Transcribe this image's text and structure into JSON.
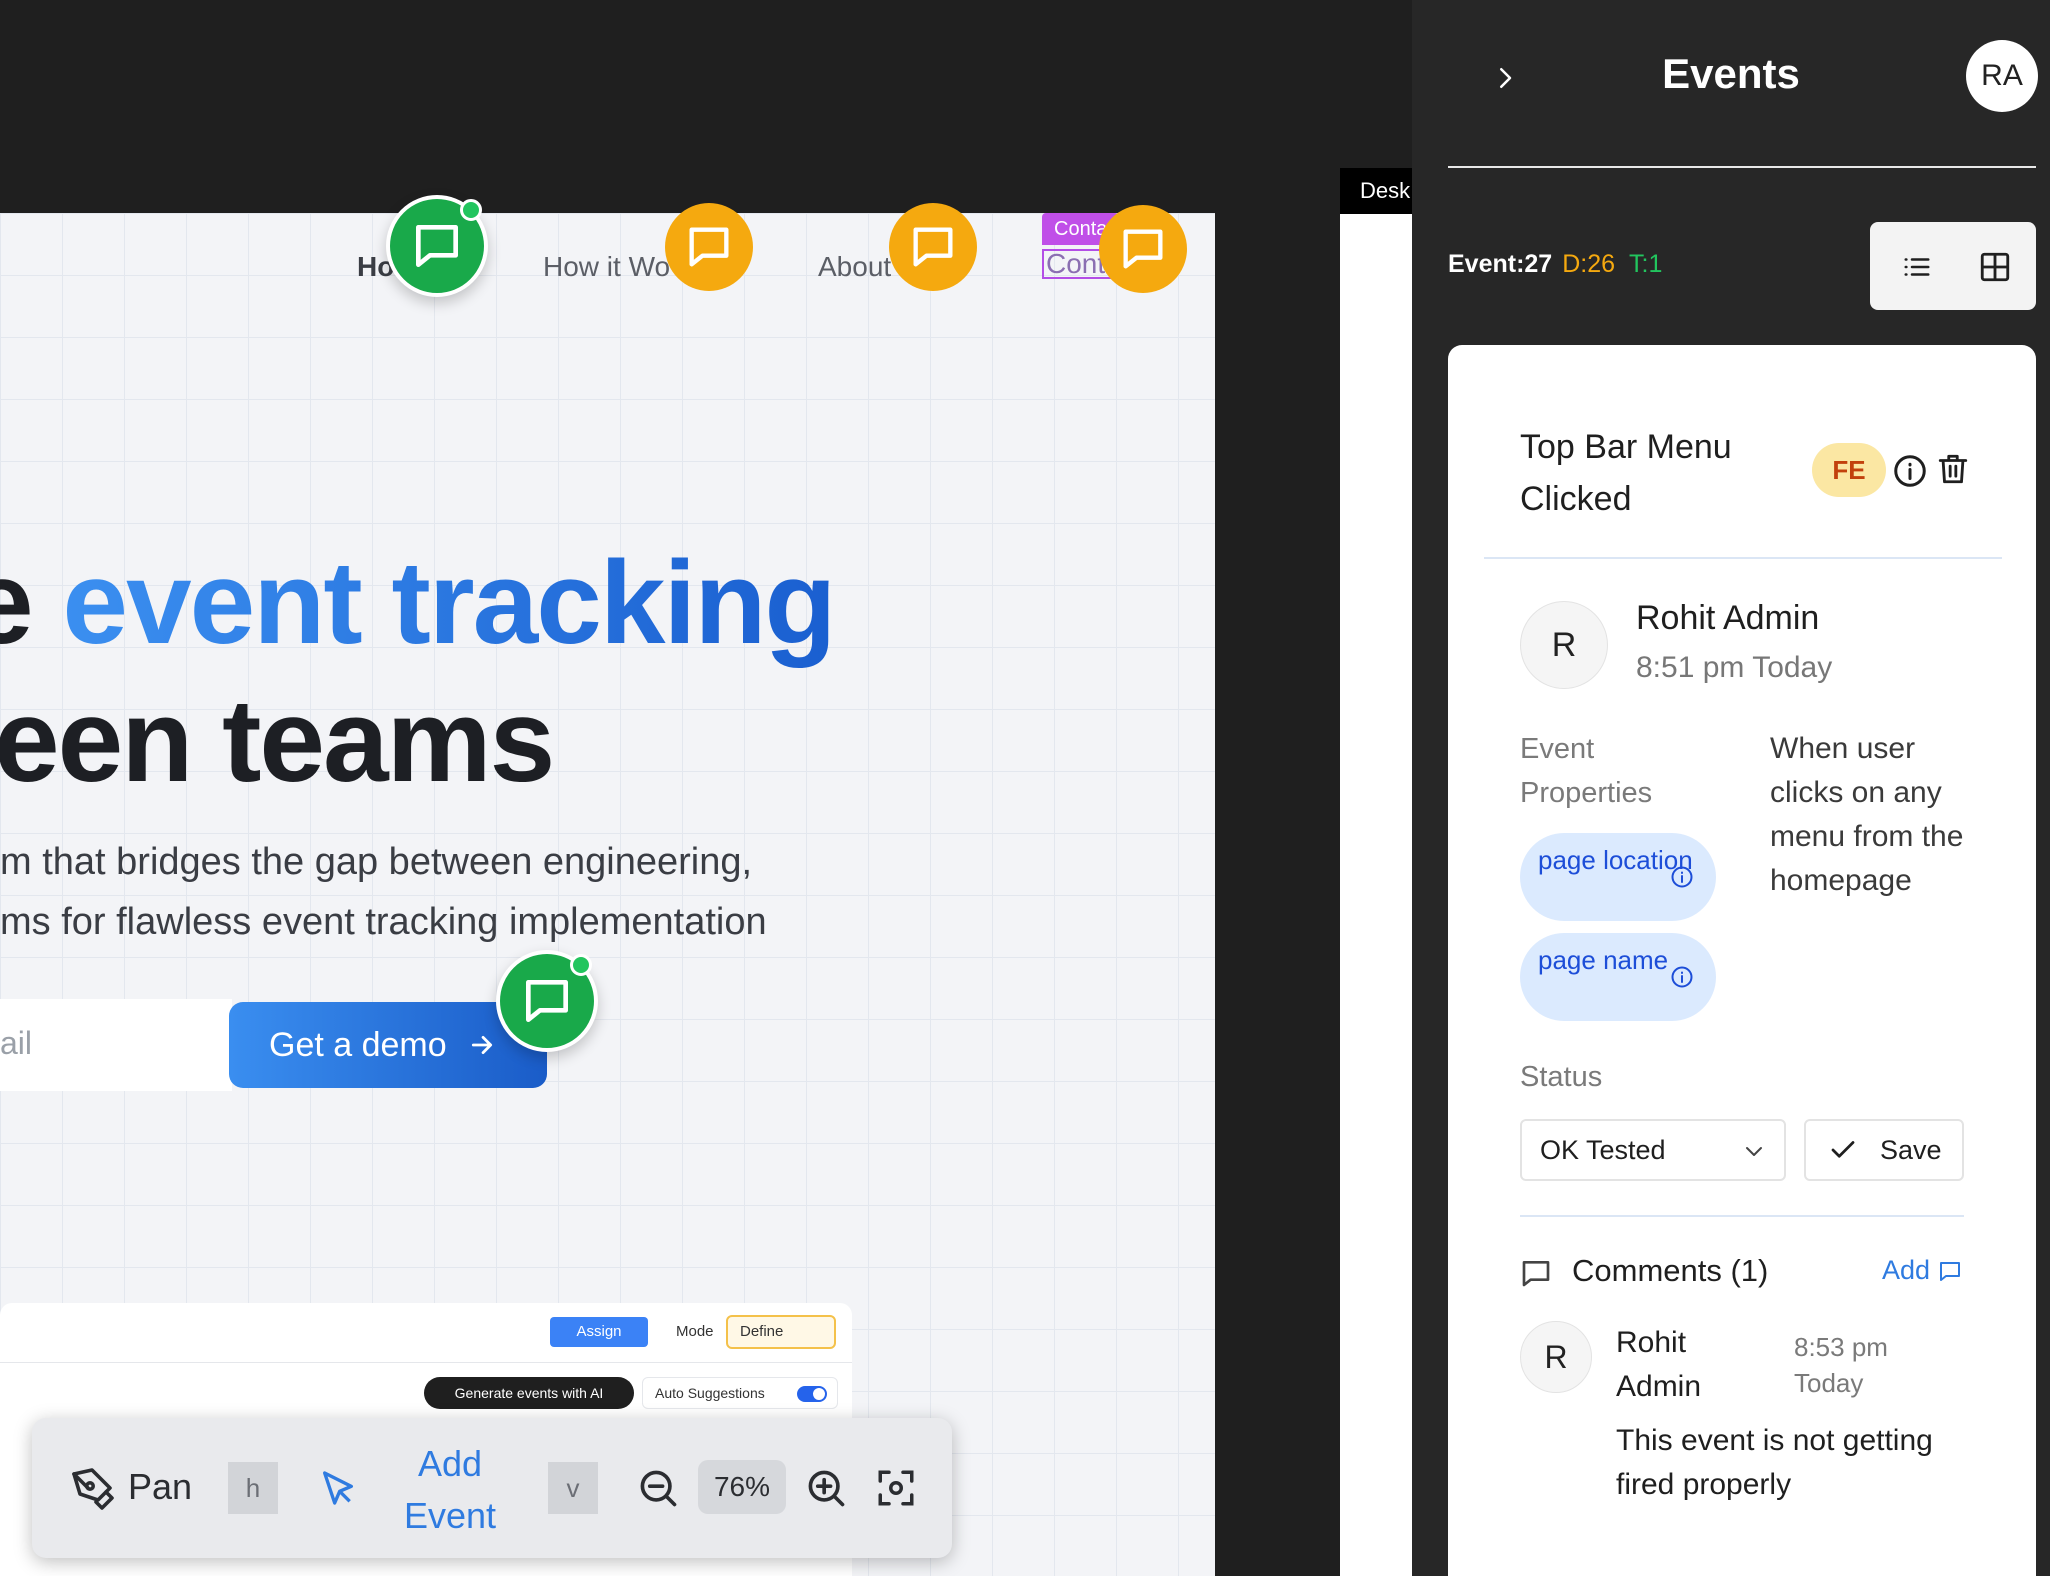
{
  "canvas": {
    "nav": {
      "home": "Ho",
      "how": "How it Wo",
      "about": "About",
      "contact": "Cont",
      "contact_tag": "Conta"
    },
    "hero": {
      "line1_prefix": "e ",
      "line1_accent": "event tracking",
      "line2": "een teams"
    },
    "subtitle": {
      "line1": "m that bridges the gap between engineering,",
      "line2": "ms for flawless event tracking implementation"
    },
    "email_placeholder": "ail",
    "demo_button": "Get a demo",
    "mock_app": {
      "assign": "Assign",
      "mode_label": "Mode",
      "mode_value": "Define",
      "generate": "Generate events with AI",
      "auto_suggestions": "Auto Suggestions"
    },
    "desktop_tab": "Desk",
    "toolbar": {
      "pan": "Pan",
      "pan_key": "h",
      "add_event": "Add Event",
      "add_key": "v",
      "zoom": "76%"
    }
  },
  "panel": {
    "title": "Events",
    "avatar": "RA",
    "counts": {
      "event": "Event:27",
      "d": "D:26",
      "t": "T:1"
    },
    "card": {
      "title": "Top Bar Menu Clicked",
      "badge": "FE",
      "owner_initial": "R",
      "owner_name": "Rohit Admin",
      "owner_time": "8:51 pm Today",
      "props_label": "Event Properties",
      "props": [
        "page location",
        "page name"
      ],
      "description": "When user clicks on any menu from the homepage",
      "status_label": "Status",
      "status_value": "OK Tested",
      "save": "Save",
      "comments_title": "Comments (1)",
      "comments_add": "Add",
      "comment": {
        "initial": "R",
        "author": "Rohit Admin",
        "time": "8:53 pm Today",
        "text": "This event is not getting fired properly"
      }
    }
  },
  "colors": {
    "accent": "#2f7be0",
    "pin_orange": "#f5a90f",
    "pin_green": "#19a94a",
    "panel_bg": "#272727"
  }
}
